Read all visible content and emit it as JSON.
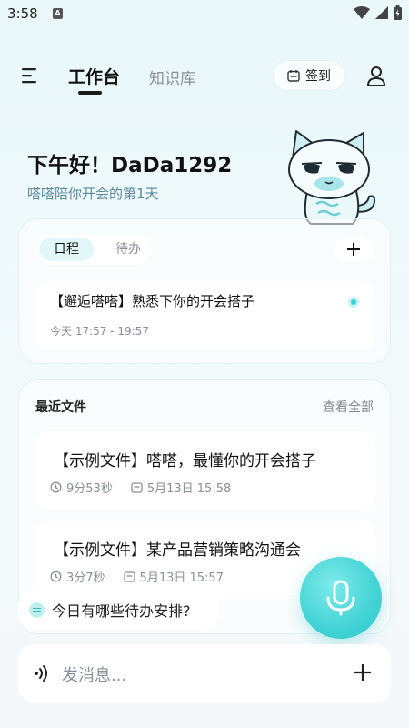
{
  "status_bar": {
    "time": "3:58",
    "notification": "A"
  },
  "header": {
    "tabs": [
      "工作台",
      "知识库"
    ],
    "checkin_label": "签到"
  },
  "greeting": {
    "title": "下午好！DaDa1292",
    "subtitle": "嗒嗒陪你开会的第1天"
  },
  "schedule": {
    "segments": [
      "日程",
      "待办"
    ],
    "event": {
      "title": "【邂逅嗒嗒】熟悉下你的开会搭子",
      "time": "今天 17:57 - 19:57"
    }
  },
  "recent_files": {
    "title": "最近文件",
    "view_all": "查看全部",
    "items": [
      {
        "title": "【示例文件】嗒嗒，最懂你的开会搭子",
        "duration": "9分53秒",
        "date": "5月13日 15:58"
      },
      {
        "title": "【示例文件】某产品营销策略沟通会",
        "duration": "3分7秒",
        "date": "5月13日 15:57"
      }
    ]
  },
  "suggestion": "今日有哪些待办安排?",
  "input": {
    "placeholder": "发消息..."
  },
  "colors": {
    "accent": "#43d3d5",
    "accent_light": "#e2f7f8",
    "muted": "#8a8f98"
  },
  "icons": [
    "menu-icon",
    "calendar-icon",
    "user-icon",
    "plus-icon",
    "clock-icon",
    "mic-icon",
    "voice-wave-icon",
    "wifi-icon",
    "signal-icon",
    "battery-icon"
  ]
}
